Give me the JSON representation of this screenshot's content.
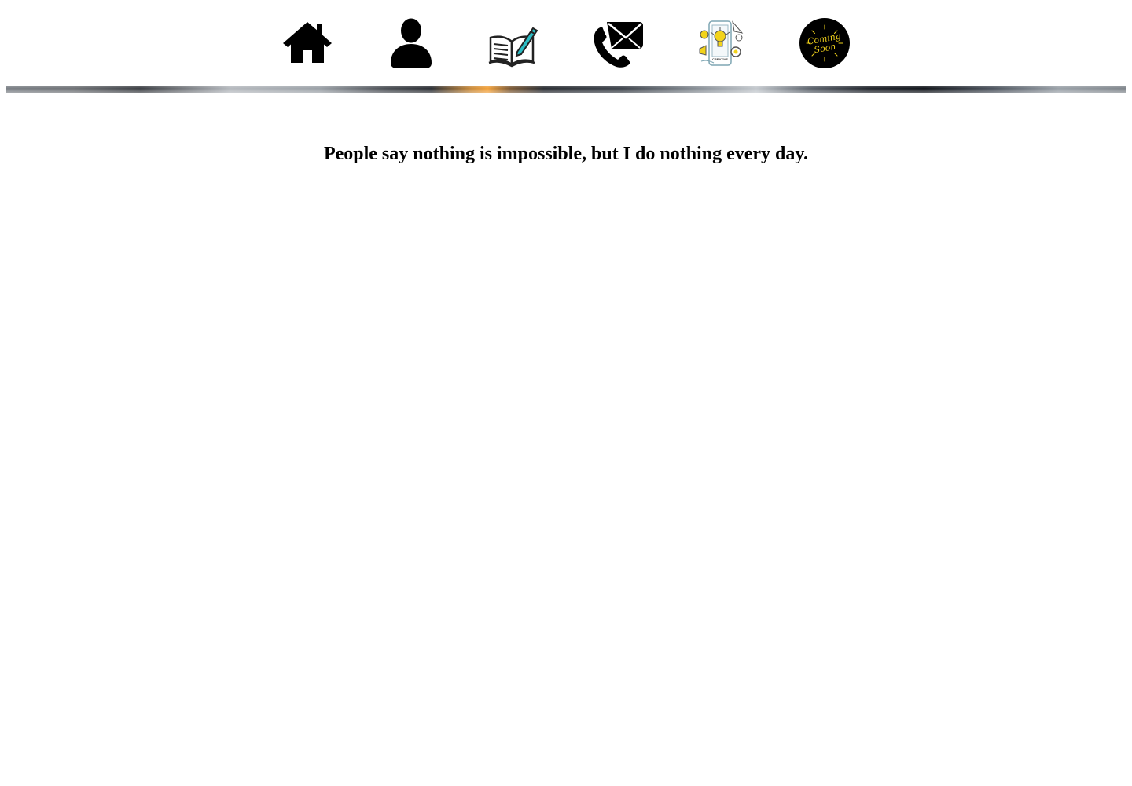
{
  "nav": {
    "items": [
      {
        "icon": "home-icon"
      },
      {
        "icon": "user-icon"
      },
      {
        "icon": "book-pen-icon"
      },
      {
        "icon": "phone-mail-icon"
      },
      {
        "icon": "ideas-illustration-icon",
        "label": "CREATIVE"
      },
      {
        "icon": "coming-soon-badge-icon",
        "label_line1": "Coming",
        "label_line2": "Soon"
      }
    ]
  },
  "banner": {
    "icon": "header-banner-image"
  },
  "main": {
    "quote": "People say nothing is impossible, but I do nothing every day."
  },
  "colors": {
    "text": "#000000",
    "background": "#ffffff",
    "badge_yellow": "#f2d31b",
    "accent_teal": "#2bbcc4"
  }
}
